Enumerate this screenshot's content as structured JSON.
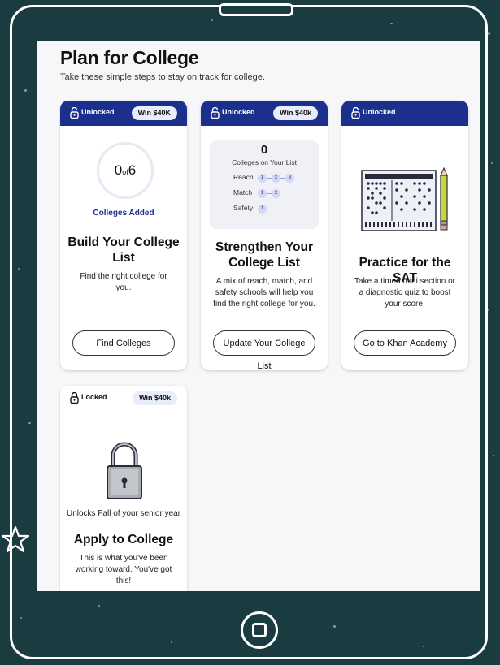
{
  "page": {
    "title": "Plan for College",
    "subtitle": "Take these simple steps to stay on track for college."
  },
  "colors": {
    "background": "#1a3b40",
    "card_header": "#1b2f8c",
    "badge": "#e8ecfb",
    "accent": "#1b2f8c"
  },
  "cards": [
    {
      "status": "Unlocked",
      "badge": "Win $40K",
      "progress_count": "0",
      "progress_of": "of",
      "progress_total": "6",
      "progress_label": "Colleges Added",
      "title": "Build Your College List",
      "description": "Find the right college for you.",
      "button": "Find Colleges",
      "icon": "unlocked-lock-icon"
    },
    {
      "status": "Unlocked",
      "badge": "Win $40k",
      "list_count": "0",
      "list_label": "Colleges on Your List",
      "rows": [
        {
          "label": "Reach",
          "dots": [
            "1",
            "2",
            "3"
          ]
        },
        {
          "label": "Match",
          "dots": [
            "1",
            "2"
          ]
        },
        {
          "label": "Safety",
          "dots": [
            "1"
          ]
        }
      ],
      "title": "Strengthen Your College List",
      "description": "A mix of reach, match, and safety schools will help you find the right college for you.",
      "button": "Update Your College List",
      "icon": "unlocked-lock-icon"
    },
    {
      "status": "Unlocked",
      "title": "Practice for the SAT",
      "description": "Take a timed mini section or a diagnostic quiz to boost your score.",
      "button": "Go to Khan Academy",
      "image": "answer-sheet-and-pencil-illustration",
      "icon": "unlocked-lock-icon"
    },
    {
      "status": "Locked",
      "badge": "Win $40k",
      "unlock_note": "Unlocks Fall of your senior year",
      "title": "Apply to College",
      "description": "This is what you've been working toward. You've got this!",
      "image": "padlock-illustration",
      "icon": "locked-lock-icon"
    }
  ],
  "device": {
    "home_button": "home-button-icon",
    "side_icon": "star-icon"
  }
}
